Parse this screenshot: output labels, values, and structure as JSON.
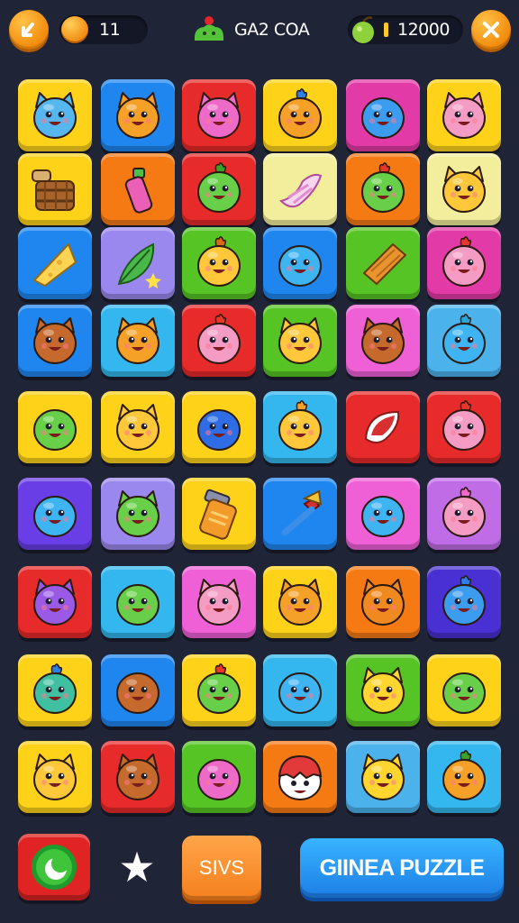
{
  "header": {
    "coins": "11",
    "title": "GA2 COA",
    "score": "12000"
  },
  "colors": {
    "yellow": "#ffd21a",
    "blue": "#1f86f0",
    "red": "#e72a2a",
    "orange": "#f57a14",
    "magenta": "#e23aa6",
    "green": "#56c424",
    "paleyellow": "#f3ee9c",
    "lilac": "#9b88ee",
    "purple": "#6a3ee6",
    "cyan": "#33b7ee",
    "pink": "#ef5fd6",
    "lightblue": "#4cb2ec",
    "violet": "#c06ce6",
    "indigo": "#4830d2"
  },
  "board": {
    "rows": [
      [
        {
          "name": "blue-cat-face",
          "color": "yellow",
          "creature": "blob",
          "face": "#56b6f0",
          "ears": true
        },
        {
          "name": "orange-cat-face",
          "color": "blue",
          "creature": "blob",
          "face": "#f5a128",
          "ears": true
        },
        {
          "name": "pink-cat-face",
          "color": "red",
          "creature": "blob",
          "face": "#ee6ac8",
          "ears": true
        },
        {
          "name": "orange-bird-face",
          "color": "yellow",
          "creature": "blob",
          "face": "#f5a128",
          "tuft": "#2f7ee6"
        },
        {
          "name": "blue-blob-face",
          "color": "magenta",
          "creature": "blob",
          "face": "#3c9cf0"
        },
        {
          "name": "pink-cat-face",
          "color": "yellow",
          "creature": "blob",
          "face": "#f59cc4",
          "ears": true
        }
      ],
      [
        {
          "name": "wooden-barrel-icon",
          "color": "yellow",
          "creature": "barrel"
        },
        {
          "name": "pink-bottle-icon",
          "color": "orange",
          "creature": "bottle"
        },
        {
          "name": "green-blob-face",
          "color": "red",
          "creature": "blob",
          "face": "#67d048",
          "tuft": "#3ca32a"
        },
        {
          "name": "pink-leaf-icon",
          "color": "paleyellow",
          "creature": "leafpink"
        },
        {
          "name": "green-blob-face",
          "color": "orange",
          "creature": "blob",
          "face": "#67d048",
          "tuft": "#e6382a"
        },
        {
          "name": "yellow-cat-face",
          "color": "paleyellow",
          "creature": "blob",
          "face": "#ffc83a",
          "ears": true
        }
      ],
      [
        {
          "name": "cheese-wedge-icon",
          "color": "blue",
          "creature": "cheese"
        },
        {
          "name": "green-leaf-icon",
          "color": "lilac",
          "creature": "leaf"
        },
        {
          "name": "yellow-root-face",
          "color": "green",
          "creature": "blob",
          "face": "#ffc83a",
          "tuft": "#d86a1a"
        },
        {
          "name": "blue-blob-face",
          "color": "blue",
          "creature": "blob",
          "face": "#3fb4f2"
        },
        {
          "name": "chocolate-bar-icon",
          "color": "green",
          "creature": "bar"
        },
        {
          "name": "pink-blob-face",
          "color": "magenta",
          "creature": "blob",
          "face": "#f59cc4",
          "tuft": "#e6382a"
        }
      ],
      [
        {
          "name": "brown-bear-face",
          "color": "blue",
          "creature": "blob",
          "face": "#c56a2c",
          "ears": true
        },
        {
          "name": "orange-cat-face",
          "color": "cyan",
          "creature": "blob",
          "face": "#f5a128",
          "ears": true
        },
        {
          "name": "pink-blob-face",
          "color": "red",
          "creature": "blob",
          "face": "#f59cc4",
          "tuft": "#e6382a"
        },
        {
          "name": "yellow-cat-face",
          "color": "green",
          "creature": "blob",
          "face": "#ffc83a",
          "ears": true
        },
        {
          "name": "brown-cat-face",
          "color": "pink",
          "creature": "blob",
          "face": "#c56a2c",
          "ears": true
        },
        {
          "name": "blue-blob-face",
          "color": "lightblue",
          "creature": "blob",
          "face": "#3fb4f2",
          "tuft": "#2aa7d8"
        }
      ],
      [
        {
          "name": "green-drop-face",
          "color": "yellow",
          "creature": "blob",
          "face": "#67d048"
        },
        {
          "name": "yellow-cat-face",
          "color": "yellow",
          "creature": "blob",
          "face": "#ffc83a",
          "ears": true
        },
        {
          "name": "blue-blob-face",
          "color": "yellow",
          "creature": "blob",
          "face": "#2f6de6"
        },
        {
          "name": "yellow-bird-face",
          "color": "cyan",
          "creature": "blob",
          "face": "#ffc83a",
          "tuft": "#f5a128"
        },
        {
          "name": "red-pepper-icon",
          "color": "red",
          "creature": "pepper"
        },
        {
          "name": "pink-blob-face",
          "color": "red",
          "creature": "blob",
          "face": "#f59cc4",
          "tuft": "#e6382a"
        }
      ],
      [
        {
          "name": "blue-drop-face",
          "color": "purple",
          "creature": "blob",
          "face": "#3fb4f2"
        },
        {
          "name": "green-cat-face",
          "color": "lilac",
          "creature": "blob",
          "face": "#67d048",
          "ears": true
        },
        {
          "name": "jam-jar-icon",
          "color": "yellow",
          "creature": "jar"
        },
        {
          "name": "ice-cream-cone-icon",
          "color": "blue",
          "creature": "cone"
        },
        {
          "name": "blue-drop-face",
          "color": "pink",
          "creature": "blob",
          "face": "#3fb4f2"
        },
        {
          "name": "pink-blob-face",
          "color": "violet",
          "creature": "blob",
          "face": "#f59cc4",
          "tuft": "#ee6ac8"
        }
      ],
      [
        {
          "name": "purple-cat-face",
          "color": "red",
          "creature": "blob",
          "face": "#9a5ae6",
          "ears": true
        },
        {
          "name": "green-drop-face",
          "color": "cyan",
          "creature": "blob",
          "face": "#67d048"
        },
        {
          "name": "pink-cat-face",
          "color": "pink",
          "creature": "blob",
          "face": "#f59cc4",
          "ears": true
        },
        {
          "name": "orange-cat-face",
          "color": "yellow",
          "creature": "blob",
          "face": "#f5a128",
          "ears": true
        },
        {
          "name": "orange-bear-face",
          "color": "orange",
          "creature": "blob",
          "face": "#f08a20",
          "ears": true
        },
        {
          "name": "blue-blob-face",
          "color": "indigo",
          "creature": "blob",
          "face": "#3c9cf0",
          "tuft": "#2f7ee6"
        }
      ],
      [
        {
          "name": "teal-bird-face",
          "color": "yellow",
          "creature": "blob",
          "face": "#3fc0a0",
          "tuft": "#2f7ee6"
        },
        {
          "name": "brown-blob-face",
          "color": "blue",
          "creature": "blob",
          "face": "#c56a2c"
        },
        {
          "name": "green-blob-face",
          "color": "yellow",
          "creature": "blob",
          "face": "#67d048",
          "tuft": "#e6382a"
        },
        {
          "name": "blue-drop-face",
          "color": "cyan",
          "creature": "blob",
          "face": "#3fb4f2"
        },
        {
          "name": "yellow-cat-face",
          "color": "green",
          "creature": "blob",
          "face": "#ffd630",
          "ears": true
        },
        {
          "name": "green-drop-face",
          "color": "yellow",
          "creature": "blob",
          "face": "#67d048"
        }
      ],
      [
        {
          "name": "yellow-cat-face",
          "color": "yellow",
          "creature": "blob",
          "face": "#ffc83a",
          "ears": true
        },
        {
          "name": "brown-cat-face",
          "color": "red",
          "creature": "blob",
          "face": "#c56a2c",
          "ears": true
        },
        {
          "name": "pink-drop-face",
          "color": "green",
          "creature": "blob",
          "face": "#ee6ac8"
        },
        {
          "name": "red-hat-face",
          "color": "orange",
          "creature": "hat"
        },
        {
          "name": "yellow-cat-face",
          "color": "lightblue",
          "creature": "blob",
          "face": "#ffd630",
          "ears": true
        },
        {
          "name": "orange-blob-face",
          "color": "cyan",
          "creature": "blob",
          "face": "#f5a128",
          "tuft": "#3ca32a"
        }
      ]
    ]
  },
  "footer": {
    "save_label": "SIVS",
    "puzzle_label": "GIINEA PUZZLE"
  }
}
